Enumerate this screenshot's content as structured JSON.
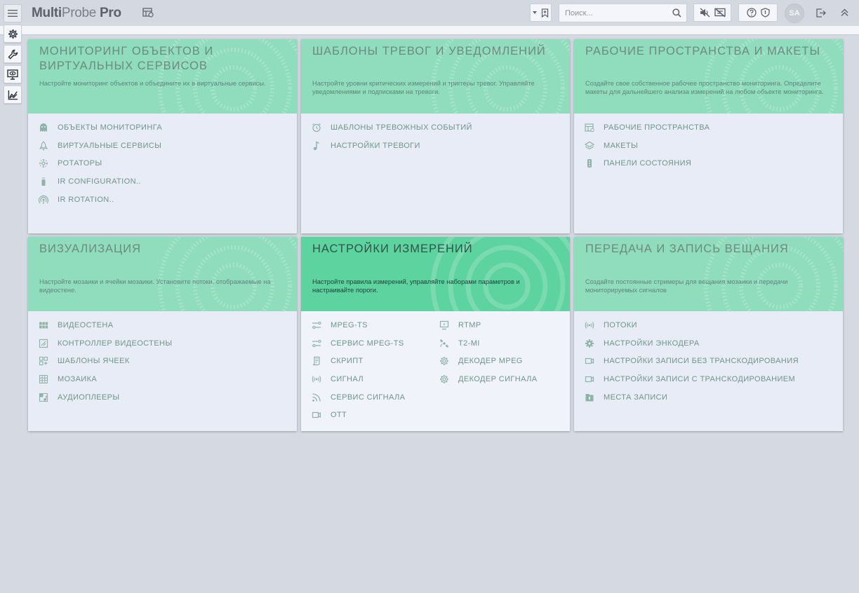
{
  "app": {
    "brand_bold": "Multi",
    "brand_light": "Probe",
    "brand_suffix": " Pro"
  },
  "search": {
    "placeholder": "Поиск..."
  },
  "user": {
    "initials": "SA"
  },
  "colors": {
    "card_header": "#8fddbd",
    "card_header_active": "#5dd3a0",
    "link_text": "#6e9588",
    "background": "#d4d9e2"
  },
  "cards": [
    {
      "title": "Мониторинг объектов и виртуальных сервисов",
      "description": "Настройте мониторинг объектов и объедините их в виртуальные сервисы.",
      "links": [
        {
          "label": "ОБЪЕКТЫ МОНИТОРИНГА",
          "icon": "ghost-icon"
        },
        {
          "label": "ВИРТУАЛЬНЫЕ СЕРВИСЫ",
          "icon": "rocket-icon"
        },
        {
          "label": "РОТАТОРЫ",
          "icon": "rotator-icon"
        },
        {
          "label": "IR CONFIGURATION..",
          "icon": "remote-icon"
        },
        {
          "label": "IR ROTATION..",
          "icon": "signal-rotation-icon"
        }
      ]
    },
    {
      "title": "Шаблоны тревог и уведомлений",
      "description": "Настройте уровни критических измерений и триггеры тревог. Управляйте уведомлениями и подписками на тревоги.",
      "links": [
        {
          "label": "ШАБЛОНЫ ТРЕВОЖНЫХ СОБЫТИЙ",
          "icon": "alarm-clock-icon"
        },
        {
          "label": "НАСТРОЙКИ ТРЕВОГИ",
          "icon": "music-note-icon"
        }
      ]
    },
    {
      "title": "Рабочие пространства и макеты",
      "description": "Создайте свое собственное рабочее пространство мониторинга. Определите макеты для дальнейшего анализа измерений на любом объекте мониторинга.",
      "links": [
        {
          "label": "РАБОЧИЕ ПРОСТРАНСТВА",
          "icon": "workspace-icon"
        },
        {
          "label": "МАКЕТЫ",
          "icon": "layers-icon"
        },
        {
          "label": "ПАНЕЛИ СОСТОЯНИЯ",
          "icon": "traffic-light-icon"
        }
      ]
    },
    {
      "title": "Визуализация",
      "description": "Настройте мозаики и ячейки мозаики. Установите потоки, отображаемые на видеостене.",
      "links": [
        {
          "label": "ВИДЕОСТЕНА",
          "icon": "videowall-icon"
        },
        {
          "label": "КОНТРОЛЛЕР ВИДЕОСТЕНЫ",
          "icon": "controller-icon"
        },
        {
          "label": "ШАБЛОНЫ ЯЧЕЕК",
          "icon": "cell-template-icon"
        },
        {
          "label": "МОЗАИКА",
          "icon": "grid-icon"
        },
        {
          "label": "АУДИОПЛЕЕРЫ",
          "icon": "audio-player-icon"
        }
      ]
    },
    {
      "title": "Настройки измерений",
      "description": "Настройте правила измерений, управляйте наборами параметров и настраивайте пороги.",
      "links": [
        {
          "label": "MPEG-TS",
          "icon": "stream-icon"
        },
        {
          "label": "СЕРВИС MPEG-TS",
          "icon": "stream-service-icon"
        },
        {
          "label": "СКРИПТ",
          "icon": "script-icon"
        },
        {
          "label": "СИГНАЛ",
          "icon": "broadcast-icon"
        },
        {
          "label": "СЕРВИС СИГНАЛА",
          "icon": "rss-icon"
        },
        {
          "label": "OTT",
          "icon": "video-camera-icon"
        }
      ],
      "links_col2": [
        {
          "label": "RTMP",
          "icon": "monitor-icon"
        },
        {
          "label": "T2-MI",
          "icon": "satellite-icon"
        },
        {
          "label": "ДЕКОДЕР MPEG",
          "icon": "gear-icon"
        },
        {
          "label": "ДЕКОДЕР СИГНАЛА",
          "icon": "gear-icon"
        }
      ]
    },
    {
      "title": "Передача и запись вещания",
      "description": "Создайте постоянные стримеры для вещания мозаики и передачи мониторируемых сигналов",
      "links": [
        {
          "label": "ПОТОКИ",
          "icon": "broadcast-icon"
        },
        {
          "label": "НАСТРОЙКИ ЭНКОДЕРА",
          "icon": "gear-icon"
        },
        {
          "label": "НАСТРОЙКИ ЗАПИСИ БЕЗ ТРАНСКОДИРОВАНИЯ",
          "icon": "video-camera-icon"
        },
        {
          "label": "НАСТРОЙКИ ЗАПИСИ С ТРАНСКОДИРОВАНИЕМ",
          "icon": "video-camera-icon"
        },
        {
          "label": "МЕСТА ЗАПИСИ",
          "icon": "folder-icon"
        }
      ]
    }
  ]
}
